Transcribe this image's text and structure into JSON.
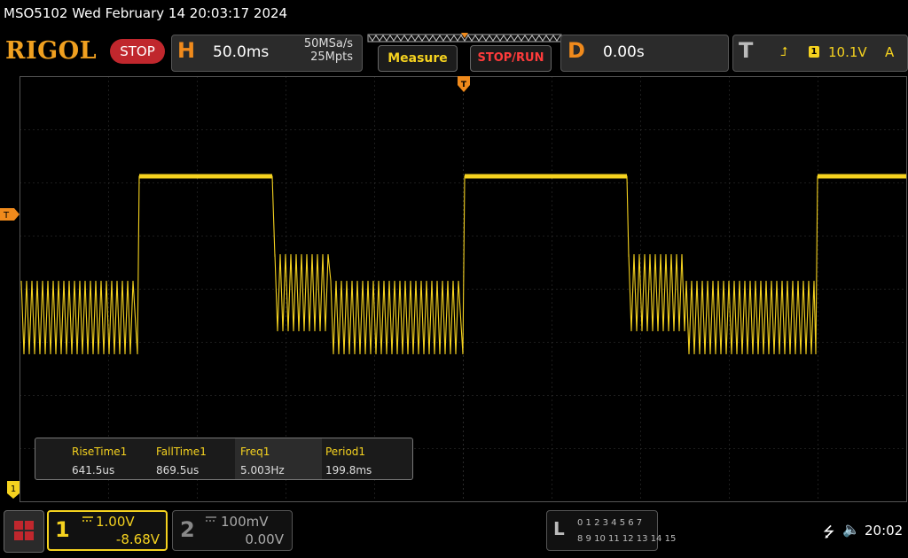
{
  "title": "MSO5102  Wed February 14 20:03:17 2024",
  "brand": {
    "logo": "RIGOL",
    "state": "STOP"
  },
  "horizontal": {
    "letter": "H",
    "timebase": "50.0ms",
    "sample_rate": "50MSa/s",
    "memory_depth": "25Mpts"
  },
  "buttons": {
    "measure": "Measure",
    "stop_run": "STOP/RUN"
  },
  "delay": {
    "letter": "D",
    "value": "0.00s"
  },
  "trigger": {
    "letter": "T",
    "edge_icon": "rising-edge-icon",
    "edge_glyph": "⮥",
    "channel": "1",
    "level": "10.1V",
    "mode": "A"
  },
  "markers": {
    "trigger_level": "T",
    "channel1": "1"
  },
  "measurements": [
    {
      "name": "RiseTime1",
      "value": "641.5us"
    },
    {
      "name": "FallTime1",
      "value": "869.5us"
    },
    {
      "name": "Freq1",
      "value": "5.003Hz"
    },
    {
      "name": "Period1",
      "value": "199.8ms"
    }
  ],
  "channel1": {
    "number": "1",
    "coupling": "DC",
    "scale": "1.00V",
    "offset": "-8.68V"
  },
  "channel2": {
    "number": "2",
    "coupling": "DC",
    "scale": "100mV",
    "offset": "0.00V"
  },
  "logic": {
    "letter": "L",
    "row1": "0 1 2 3  4 5 6 7",
    "row2": "8 9 10 11  12 13 14 15"
  },
  "status": {
    "time": "20:02",
    "usb_glyph": "⭍",
    "sound_glyph": "🔈"
  },
  "colors": {
    "ch1": "#f5d21f",
    "accent": "#f08a1c",
    "stop": "#c0272d",
    "grid": "#3a3a3a"
  }
}
